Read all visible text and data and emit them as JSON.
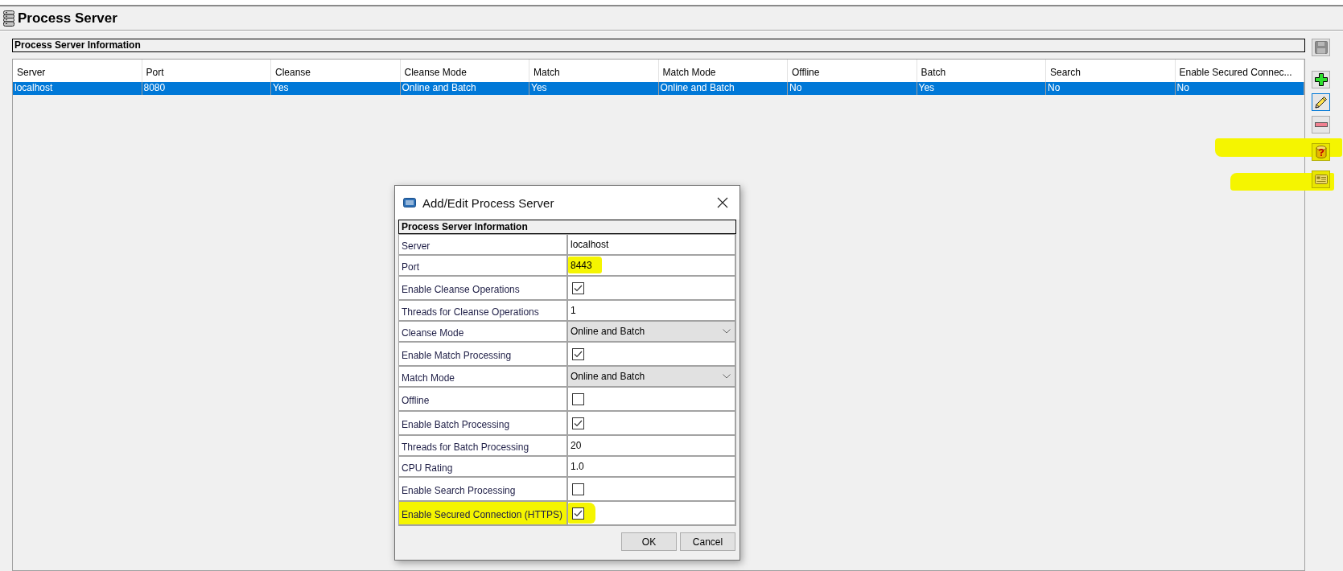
{
  "page": {
    "title": "Process Server"
  },
  "section": {
    "title": "Process Server Information"
  },
  "table": {
    "columns": [
      "Server",
      "Port",
      "Cleanse",
      "Cleanse Mode",
      "Match",
      "Match Mode",
      "Offline",
      "Batch",
      "Search",
      "Enable Secured Connec..."
    ],
    "rows": [
      {
        "selected": true,
        "cells": [
          "localhost",
          "8080",
          "Yes",
          "Online and Batch",
          "Yes",
          "Online and Batch",
          "No",
          "Yes",
          "No",
          "No"
        ]
      }
    ]
  },
  "toolbar": [
    {
      "kind": "save",
      "disabled": true,
      "focused": false,
      "highlighted": false
    },
    {
      "kind": "add",
      "disabled": false,
      "focused": false,
      "highlighted": false
    },
    {
      "kind": "edit",
      "disabled": false,
      "focused": true,
      "highlighted": false
    },
    {
      "kind": "remove",
      "disabled": false,
      "focused": false,
      "highlighted": false
    },
    {
      "kind": "help",
      "disabled": false,
      "focused": false,
      "highlighted": true
    },
    {
      "kind": "card",
      "disabled": false,
      "focused": false,
      "highlighted": true
    }
  ],
  "dialog": {
    "title": "Add/Edit Process Server",
    "section_title": "Process Server Information",
    "fields": [
      {
        "kind": "text",
        "label": "Server",
        "value": "localhost",
        "highlighted": false
      },
      {
        "kind": "text",
        "label": "Port",
        "value": "8443",
        "highlighted": true
      },
      {
        "kind": "checkbox",
        "label": "Enable Cleanse Operations",
        "checked": true,
        "highlighted": false
      },
      {
        "kind": "text",
        "label": "Threads for Cleanse Operations",
        "value": "1",
        "highlighted": false
      },
      {
        "kind": "dropdown",
        "label": "Cleanse Mode",
        "value": "Online and Batch",
        "highlighted": false
      },
      {
        "kind": "checkbox",
        "label": "Enable Match Processing",
        "checked": true,
        "highlighted": false
      },
      {
        "kind": "dropdown",
        "label": "Match Mode",
        "value": "Online and Batch",
        "highlighted": false
      },
      {
        "kind": "checkbox",
        "label": "Offline",
        "checked": false,
        "highlighted": false
      },
      {
        "kind": "checkbox",
        "label": "Enable Batch Processing",
        "checked": true,
        "highlighted": false
      },
      {
        "kind": "text",
        "label": "Threads for Batch Processing",
        "value": "20",
        "highlighted": false
      },
      {
        "kind": "text",
        "label": "CPU Rating",
        "value": "1.0",
        "highlighted": false
      },
      {
        "kind": "checkbox",
        "label": "Enable Search Processing",
        "checked": false,
        "highlighted": false
      },
      {
        "kind": "checkbox",
        "label": "Enable Secured Connection (HTTPS)",
        "checked": true,
        "highlighted": true
      }
    ],
    "buttons": [
      "OK",
      "Cancel"
    ]
  }
}
